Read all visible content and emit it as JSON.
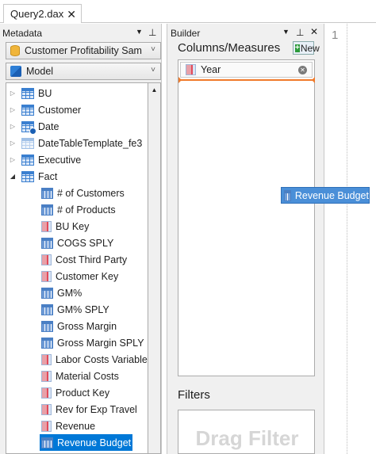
{
  "document_tab": {
    "label": "Query2.dax",
    "close": "✕"
  },
  "metadata": {
    "title": "Metadata",
    "dropdown_glyph": "▼",
    "pin_glyph": "⊥",
    "database": "Customer Profitability Sam",
    "model": "Model",
    "tables": [
      {
        "label": "BU",
        "expanded": false
      },
      {
        "label": "Customer",
        "expanded": false
      },
      {
        "label": "Date",
        "expanded": false
      },
      {
        "label": "DateTableTemplate_fe3",
        "expanded": false
      },
      {
        "label": "Executive",
        "expanded": false
      },
      {
        "label": "Fact",
        "expanded": true
      }
    ],
    "fact_fields": [
      {
        "label": "# of Customers",
        "kind": "measure"
      },
      {
        "label": "# of Products",
        "kind": "measure"
      },
      {
        "label": "BU Key",
        "kind": "column"
      },
      {
        "label": "COGS SPLY",
        "kind": "measure"
      },
      {
        "label": "Cost Third Party",
        "kind": "column"
      },
      {
        "label": "Customer Key",
        "kind": "column"
      },
      {
        "label": "GM%",
        "kind": "measure"
      },
      {
        "label": "GM% SPLY",
        "kind": "measure"
      },
      {
        "label": "Gross Margin",
        "kind": "measure"
      },
      {
        "label": "Gross Margin SPLY",
        "kind": "measure"
      },
      {
        "label": "Labor Costs Variable",
        "kind": "column"
      },
      {
        "label": "Material Costs",
        "kind": "column"
      },
      {
        "label": "Product Key",
        "kind": "column"
      },
      {
        "label": "Rev for Exp Travel",
        "kind": "column"
      },
      {
        "label": "Revenue",
        "kind": "column"
      },
      {
        "label": "Revenue Budget",
        "kind": "measure",
        "selected": true
      }
    ]
  },
  "builder": {
    "title": "Builder",
    "dropdown_glyph": "▼",
    "pin_glyph": "⊥",
    "close_glyph": "✕",
    "columns_title": "Columns/Measures",
    "new_label": "New",
    "column_items": [
      {
        "label": "Year"
      }
    ],
    "filters_title": "Filters",
    "filter_placeholder": "Drag Filter"
  },
  "editor": {
    "line_number": "1"
  },
  "drag_ghost": {
    "label": "Revenue Budget"
  },
  "colors": {
    "selection": "#0078d7",
    "insert_marker": "#f07a2a",
    "ghost": "#4a8fd8"
  }
}
